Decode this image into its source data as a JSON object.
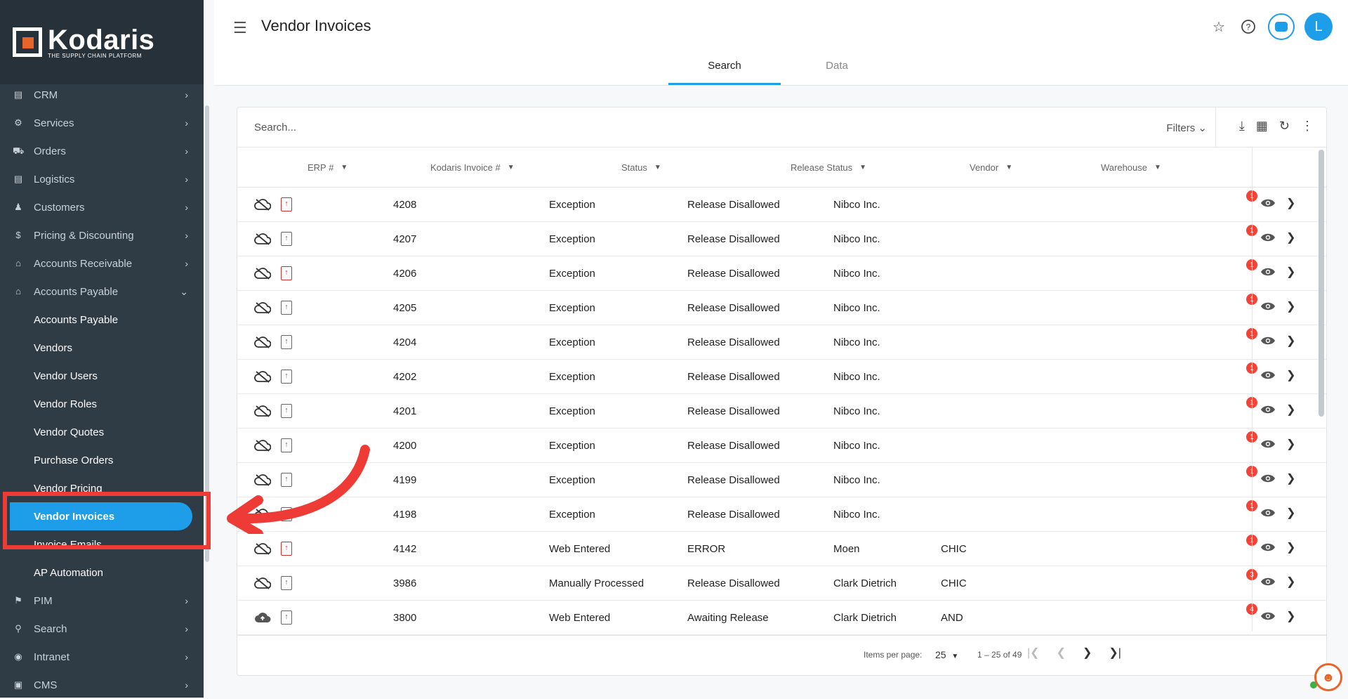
{
  "brand": {
    "name": "Kodaris",
    "tagline": "THE SUPPLY CHAIN PLATFORM",
    "accent": "#1e9ee8",
    "logo_orange": "#e8642a"
  },
  "sidebar": {
    "items": [
      {
        "label": "CRM",
        "icon": "contacts-icon"
      },
      {
        "label": "Services",
        "icon": "services-icon"
      },
      {
        "label": "Orders",
        "icon": "truck-icon"
      },
      {
        "label": "Logistics",
        "icon": "logistics-icon"
      },
      {
        "label": "Customers",
        "icon": "people-icon"
      },
      {
        "label": "Pricing & Discounting",
        "icon": "dollar-icon"
      },
      {
        "label": "Accounts Receivable",
        "icon": "bank-icon"
      },
      {
        "label": "Accounts Payable",
        "icon": "bank-icon"
      }
    ],
    "ap_sub": [
      "Accounts Payable",
      "Vendors",
      "Vendor Users",
      "Vendor Roles",
      "Vendor Quotes",
      "Purchase Orders",
      "Vendor Pricing",
      "Vendor Invoices",
      "Invoice Emails",
      "AP Automation"
    ],
    "bottom_items": [
      {
        "label": "PIM",
        "icon": "tag-icon"
      },
      {
        "label": "Search",
        "icon": "search-icon"
      },
      {
        "label": "Intranet",
        "icon": "globe-icon"
      },
      {
        "label": "CMS",
        "icon": "cms-icon"
      }
    ]
  },
  "header": {
    "title": "Vendor Invoices",
    "avatar_letter": "L"
  },
  "tabs": [
    "Search",
    "Data"
  ],
  "search": {
    "placeholder": "Search...",
    "filters_label": "Filters"
  },
  "table": {
    "columns": [
      "ERP #",
      "Kodaris Invoice #",
      "Status",
      "Release Status",
      "Vendor",
      "Warehouse"
    ],
    "rows": [
      {
        "invoice": "4208",
        "status": "Exception",
        "release": "Release Disallowed",
        "vendor": "Nibco Inc.",
        "warehouse": "",
        "badge": "1",
        "red_doc": true,
        "cloud": "off"
      },
      {
        "invoice": "4207",
        "status": "Exception",
        "release": "Release Disallowed",
        "vendor": "Nibco Inc.",
        "warehouse": "",
        "badge": "1",
        "red_doc": false,
        "cloud": "off"
      },
      {
        "invoice": "4206",
        "status": "Exception",
        "release": "Release Disallowed",
        "vendor": "Nibco Inc.",
        "warehouse": "",
        "badge": "1",
        "red_doc": true,
        "cloud": "off"
      },
      {
        "invoice": "4205",
        "status": "Exception",
        "release": "Release Disallowed",
        "vendor": "Nibco Inc.",
        "warehouse": "",
        "badge": "1",
        "red_doc": false,
        "cloud": "off"
      },
      {
        "invoice": "4204",
        "status": "Exception",
        "release": "Release Disallowed",
        "vendor": "Nibco Inc.",
        "warehouse": "",
        "badge": "1",
        "red_doc": false,
        "cloud": "off"
      },
      {
        "invoice": "4202",
        "status": "Exception",
        "release": "Release Disallowed",
        "vendor": "Nibco Inc.",
        "warehouse": "",
        "badge": "1",
        "red_doc": false,
        "cloud": "off"
      },
      {
        "invoice": "4201",
        "status": "Exception",
        "release": "Release Disallowed",
        "vendor": "Nibco Inc.",
        "warehouse": "",
        "badge": "1",
        "red_doc": false,
        "cloud": "off"
      },
      {
        "invoice": "4200",
        "status": "Exception",
        "release": "Release Disallowed",
        "vendor": "Nibco Inc.",
        "warehouse": "",
        "badge": "1",
        "red_doc": false,
        "cloud": "off"
      },
      {
        "invoice": "4199",
        "status": "Exception",
        "release": "Release Disallowed",
        "vendor": "Nibco Inc.",
        "warehouse": "",
        "badge": "1",
        "red_doc": false,
        "cloud": "off"
      },
      {
        "invoice": "4198",
        "status": "Exception",
        "release": "Release Disallowed",
        "vendor": "Nibco Inc.",
        "warehouse": "",
        "badge": "1",
        "red_doc": false,
        "cloud": "off"
      },
      {
        "invoice": "4142",
        "status": "Web Entered",
        "release": "ERROR",
        "vendor": "Moen",
        "warehouse": "CHIC",
        "badge": "1",
        "red_doc": true,
        "cloud": "off"
      },
      {
        "invoice": "3986",
        "status": "Manually Processed",
        "release": "Release Disallowed",
        "vendor": "Clark Dietrich",
        "warehouse": "CHIC",
        "badge": "3",
        "red_doc": false,
        "cloud": "off"
      },
      {
        "invoice": "3800",
        "status": "Web Entered",
        "release": "Awaiting Release",
        "vendor": "Clark Dietrich",
        "warehouse": "AND",
        "badge": "4",
        "red_doc": false,
        "cloud": "on"
      }
    ]
  },
  "paginator": {
    "items_per_page_label": "Items per page:",
    "items_per_page": "25",
    "range": "1 – 25 of 49"
  }
}
